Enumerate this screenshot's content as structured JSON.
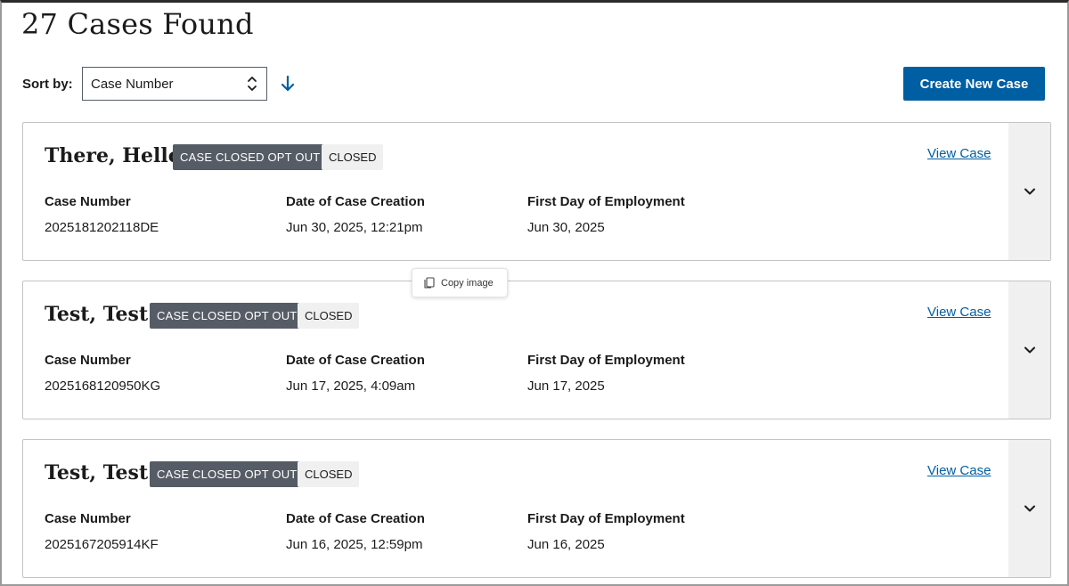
{
  "header": {
    "title": "27 Cases Found"
  },
  "sort": {
    "label": "Sort by:",
    "selected": "Case Number",
    "direction_icon": "arrow-down-icon"
  },
  "actions": {
    "create_label": "Create New Case"
  },
  "colors": {
    "primary": "#005ea2",
    "tag_dark": "#565c65",
    "tag_light": "#f0f0f0",
    "border": "#c4c4c4"
  },
  "field_labels": {
    "case_number": "Case Number",
    "date_created": "Date of Case Creation",
    "first_day": "First Day of Employment"
  },
  "cases": [
    {
      "name": "There, Hello",
      "status_tag": "CASE CLOSED OPT OUT",
      "state_tag": "CLOSED",
      "view_label": "View Case",
      "case_number": "2025181202118DE",
      "date_created": "Jun 30, 2025, 12:21pm",
      "first_day": "Jun 30, 2025"
    },
    {
      "name": "Test, Test",
      "status_tag": "CASE CLOSED OPT OUT",
      "state_tag": "CLOSED",
      "view_label": "View Case",
      "case_number": "2025168120950KG",
      "date_created": "Jun 17, 2025, 4:09am",
      "first_day": "Jun 17, 2025"
    },
    {
      "name": "Test, Test",
      "status_tag": "CASE CLOSED OPT OUT",
      "state_tag": "CLOSED",
      "view_label": "View Case",
      "case_number": "2025167205914KF",
      "date_created": "Jun 16, 2025, 12:59pm",
      "first_day": "Jun 16, 2025"
    }
  ],
  "popup": {
    "copy_label": "Copy image"
  }
}
